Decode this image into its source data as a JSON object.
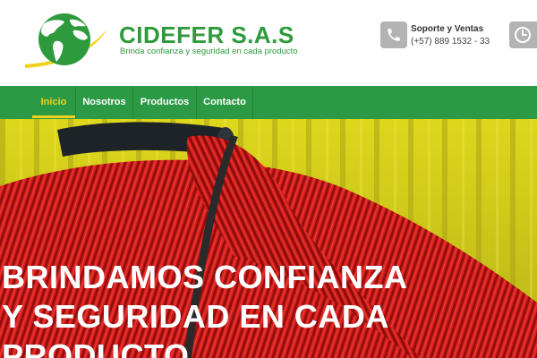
{
  "brand": {
    "name": "CIDEFER S.A.S",
    "tagline": "Brinda confianza y seguridad en cada producto"
  },
  "contact": {
    "title": "Soporte y Ventas",
    "phone": "(+57) 889 1532 - 33",
    "phone_icon": "phone-icon",
    "clock_icon": "clock-icon"
  },
  "nav": {
    "items": [
      {
        "label": "Inicio",
        "active": true
      },
      {
        "label": "Nosotros",
        "active": false
      },
      {
        "label": "Productos",
        "active": false
      },
      {
        "label": "Contacto",
        "active": false
      }
    ]
  },
  "hero": {
    "line1": "BRINDAMOS CONFIANZA",
    "line2": "Y SEGURIDAD EN CADA",
    "line3": "PRODUCTO"
  },
  "colors": {
    "brand_green": "#2f9a3d",
    "nav_green": "#2c9a45",
    "accent_yellow": "#f2d11c",
    "pipe_red": "#d61d1d"
  }
}
